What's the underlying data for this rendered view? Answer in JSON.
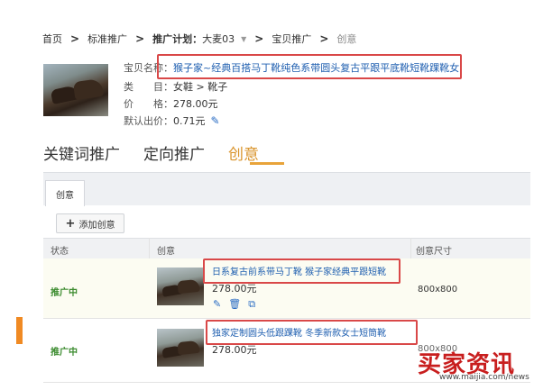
{
  "breadcrumb": {
    "home": "首页",
    "level2": "标准推广",
    "plan_label": "推广计划：",
    "plan_value": "大麦03",
    "level4": "宝贝推广",
    "current": "创意"
  },
  "product": {
    "name_label": "宝贝名称：",
    "name_value": "猴子家~经典百搭马丁靴纯色系带圆头复古平跟平底靴短靴踝靴女",
    "category_label": "类　　目：",
    "category_value": "女鞋 > 靴子",
    "price_label": "价　　格：",
    "price_value": "278.00元",
    "default_bid_label": "默认出价：",
    "default_bid_value": "0.71元"
  },
  "main_tabs": [
    "关键词推广",
    "定向推广",
    "创意"
  ],
  "active_tab": "创意",
  "sub_tab": "创意",
  "add_button": "添加创意",
  "table": {
    "headers": [
      "状态",
      "创意",
      "创意尺寸"
    ],
    "rows": [
      {
        "status": "推广中",
        "title": "日系复古前系带马丁靴 猴子家经典平跟短靴",
        "price": "278.00元",
        "size": "800x800"
      },
      {
        "status": "推广中",
        "title": "独家定制圆头低跟踝靴 冬季新款女士短筒靴",
        "price": "278.00元",
        "size": "800x800"
      }
    ]
  },
  "watermark": {
    "text": "买家资讯",
    "url": "www.maijia.com/news"
  },
  "colors": {
    "accent": "#e8a33a",
    "link": "#1f5fb0",
    "status_green": "#3b8b2e",
    "highlight_red": "#d94848",
    "watermark_red": "#c81e1e"
  }
}
